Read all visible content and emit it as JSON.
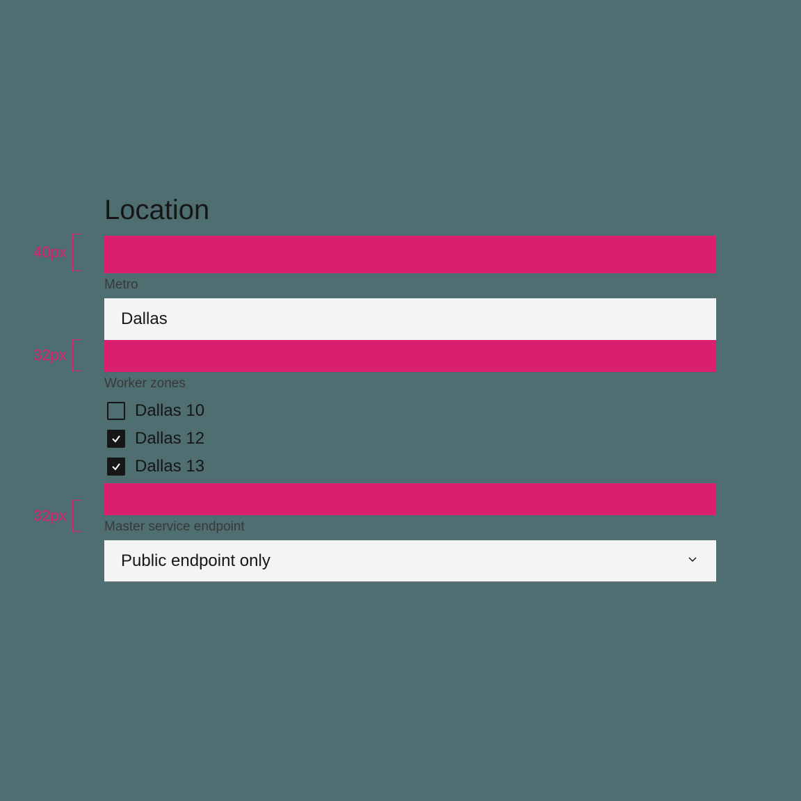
{
  "colors": {
    "accent": "#da1e70",
    "field_bg": "#f4f4f4",
    "page_bg": "#4e6e71",
    "text": "#161616",
    "label": "#393939"
  },
  "spec_annotations": {
    "spacer_heading": "40px",
    "spacer_field_1": "32px",
    "spacer_field_2": "32px"
  },
  "form": {
    "heading": "Location",
    "metro": {
      "label": "Metro",
      "value": "Dallas"
    },
    "worker_zones": {
      "label": "Worker zones",
      "options": [
        {
          "label": "Dallas 10",
          "checked": false
        },
        {
          "label": "Dallas 12",
          "checked": true
        },
        {
          "label": "Dallas 13",
          "checked": true
        }
      ]
    },
    "master_endpoint": {
      "label": "Master service endpoint",
      "value": "Public endpoint only"
    }
  }
}
